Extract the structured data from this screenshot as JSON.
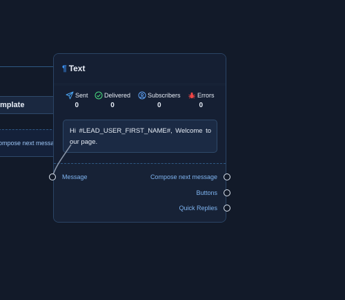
{
  "left_node": {
    "title": "mplate",
    "compose_label": "ompose next message"
  },
  "node": {
    "title": "Text",
    "stats": [
      {
        "label": "Sent",
        "value": "0",
        "icon": "paper-plane-icon",
        "color": "#4aa3f0"
      },
      {
        "label": "Delivered",
        "value": "0",
        "icon": "check-circle-icon",
        "color": "#4ade80"
      },
      {
        "label": "Subscribers",
        "value": "0",
        "icon": "user-circle-icon",
        "color": "#60a5fa"
      },
      {
        "label": "Errors",
        "value": "0",
        "icon": "bug-icon",
        "color": "#ef4444"
      }
    ],
    "message": "Hi #LEAD_USER_FIRST_NAME#, Welcome to our page.",
    "input_label": "Message",
    "outputs": {
      "compose": "Compose next message",
      "buttons": "Buttons",
      "quick_replies": "Quick Replies"
    }
  }
}
